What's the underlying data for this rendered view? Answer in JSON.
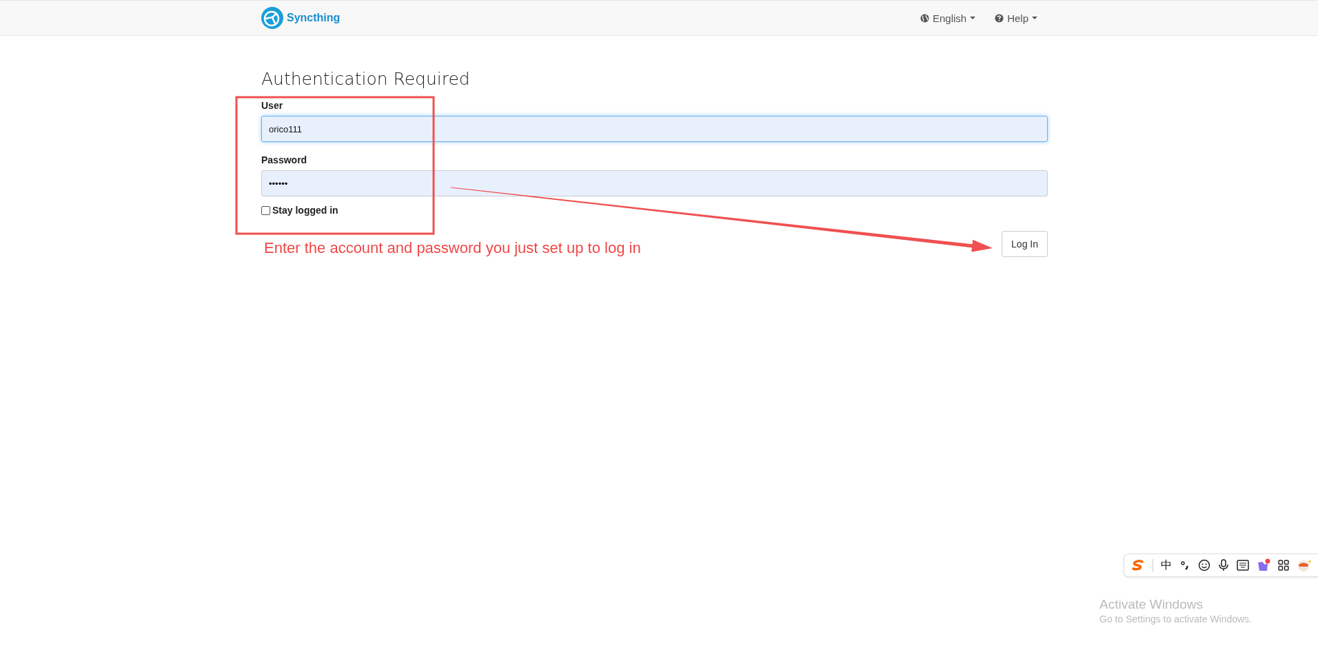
{
  "navbar": {
    "brand": "Syncthing",
    "menus": [
      {
        "label": "English",
        "kind": "language"
      },
      {
        "label": "Help",
        "kind": "help"
      }
    ]
  },
  "title": "Authentication Required",
  "fields": [
    {
      "label": "User",
      "value": "orico111",
      "focused": true
    },
    {
      "label": "Password",
      "value": "••••••",
      "focused": false
    }
  ],
  "stay_logged_in": {
    "label": "Stay logged in",
    "checked": false
  },
  "annotation": "Enter the account and password you just set up to log in",
  "login_button": "Log In",
  "ime_toolbar": {
    "mode": "中"
  },
  "activation_notice": {
    "title": "Activate Windows",
    "subtitle": "Go to Settings to activate Windows."
  }
}
